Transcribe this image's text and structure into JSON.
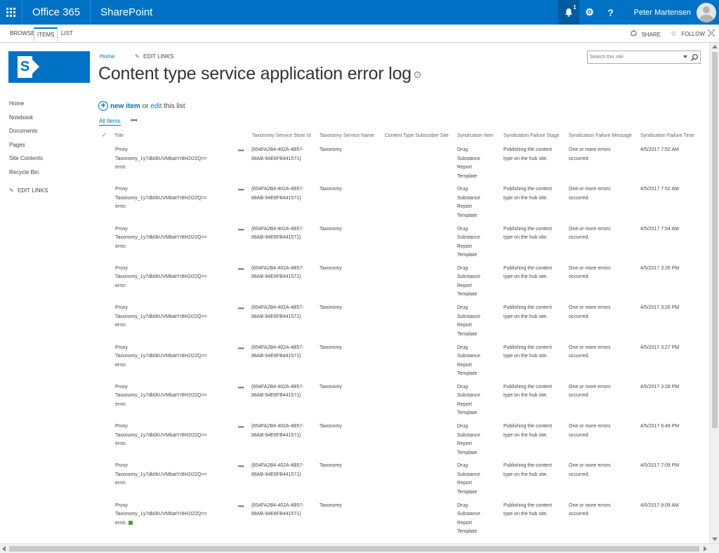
{
  "suite": {
    "brand": "Office 365",
    "app": "SharePoint",
    "notification_count": "1",
    "user_name": "Peter Martensen",
    "settings_glyph": "⚙",
    "help_glyph": "?",
    "bell_glyph": "🔔"
  },
  "ribbon": {
    "tabs": [
      "BROWSE",
      "ITEMS",
      "LIST"
    ],
    "selected_tab": "ITEMS",
    "share_label": "SHARE",
    "follow_label": "FOLLOW"
  },
  "logo": {
    "letter": "S"
  },
  "breadcrumb": {
    "home": "Home",
    "edit_links": "EDIT LINKS"
  },
  "page": {
    "title": "Content type service application error log"
  },
  "search": {
    "placeholder": "Search this site"
  },
  "leftnav": {
    "items": [
      "Home",
      "Notebook",
      "Documents",
      "Pages",
      "Site Contents",
      "Recycle Bin"
    ],
    "edit_links": "EDIT LINKS"
  },
  "commands": {
    "new_item": "new item",
    "or": " or ",
    "edit": "edit",
    "this_list": " this list",
    "view": "All Items",
    "more": "•••"
  },
  "list": {
    "columns": {
      "title": "Title",
      "store_id": "Taxonomy Service Store Id",
      "service_name": "Taxonomy Service Name",
      "subscriber_site": "Content Type Subscriber Site",
      "syndication_item": "Syndication Item",
      "failure_stage": "Syndication Failure Stage",
      "failure_message": "Syndication Failure Message",
      "failure_time": "Syndication Failure Time"
    },
    "rows": [
      {
        "title_line1": "Proxy",
        "title_line2": "Taxonomy_1y7db0kUVMbatYr8H2I22Q==",
        "title_line3": "error.",
        "store1": "{654FA2B4-402A-4B57-",
        "store2": "88AB-94E6FB441571}",
        "service": "Taxonomy",
        "item1": "Drug",
        "item2": "Substance",
        "item3": "Report",
        "item4": "Template",
        "stage1": "Publishing the content",
        "stage2": "type on the hub site.",
        "msg1": "One or more errors",
        "msg2": "occurred.",
        "time": "4/5/2017 7:52 AM"
      },
      {
        "title_line1": "Proxy",
        "title_line2": "Taxonomy_1y7db0kUVMbatYr8H2I22Q==",
        "title_line3": "error.",
        "store1": "{654FA2B4-402A-4B57-",
        "store2": "88AB-94E6FB441571}",
        "service": "Taxonomy",
        "item1": "Drug",
        "item2": "Substance",
        "item3": "Report",
        "item4": "Template",
        "stage1": "Publishing the content",
        "stage2": "type on the hub site.",
        "msg1": "One or more errors",
        "msg2": "occurred.",
        "time": "4/5/2017 7:52 AM"
      },
      {
        "title_line1": "Proxy",
        "title_line2": "Taxonomy_1y7db0kUVMbatYr8H2I22Q==",
        "title_line3": "error.",
        "store1": "{654FA2B4-402A-4B57-",
        "store2": "88AB-94E6FB441571}",
        "service": "Taxonomy",
        "item1": "Drug",
        "item2": "Substance",
        "item3": "Report",
        "item4": "Template",
        "stage1": "Publishing the content",
        "stage2": "type on the hub site.",
        "msg1": "One or more errors",
        "msg2": "occurred.",
        "time": "4/5/2017 7:54 AM"
      },
      {
        "title_line1": "Proxy",
        "title_line2": "Taxonomy_1y7db0kUVMbatYr8H2I22Q==",
        "title_line3": "error.",
        "store1": "{654FA2B4-402A-4B57-",
        "store2": "88AB-94E6FB441571}",
        "service": "Taxonomy",
        "item1": "Drug",
        "item2": "Substance",
        "item3": "Report",
        "item4": "Template",
        "stage1": "Publishing the content",
        "stage2": "type on the hub site.",
        "msg1": "One or more errors",
        "msg2": "occurred.",
        "time": "4/5/2017 3:26 PM"
      },
      {
        "title_line1": "Proxy",
        "title_line2": "Taxonomy_1y7db0kUVMbatYr8H2I22Q==",
        "title_line3": "error.",
        "store1": "{654FA2B4-402A-4B57-",
        "store2": "88AB-94E6FB441571}",
        "service": "Taxonomy",
        "item1": "Drug",
        "item2": "Substance",
        "item3": "Report",
        "item4": "Template",
        "stage1": "Publishing the content",
        "stage2": "type on the hub site.",
        "msg1": "One or more errors",
        "msg2": "occurred.",
        "time": "4/5/2017 3:26 PM"
      },
      {
        "title_line1": "Proxy",
        "title_line2": "Taxonomy_1y7db0kUVMbatYr8H2I22Q==",
        "title_line3": "error.",
        "store1": "{654FA2B4-402A-4B57-",
        "store2": "88AB-94E6FB441571}",
        "service": "Taxonomy",
        "item1": "Drug",
        "item2": "Substance",
        "item3": "Report",
        "item4": "Template",
        "stage1": "Publishing the content",
        "stage2": "type on the hub site.",
        "msg1": "One or more errors",
        "msg2": "occurred.",
        "time": "4/5/2017 3:27 PM"
      },
      {
        "title_line1": "Proxy",
        "title_line2": "Taxonomy_1y7db0kUVMbatYr8H2I22Q==",
        "title_line3": "error.",
        "store1": "{654FA2B4-402A-4B57-",
        "store2": "88AB-94E6FB441571}",
        "service": "Taxonomy",
        "item1": "Drug",
        "item2": "Substance",
        "item3": "Report",
        "item4": "Template",
        "stage1": "Publishing the content",
        "stage2": "type on the hub site.",
        "msg1": "One or more errors",
        "msg2": "occurred.",
        "time": "4/5/2017 3:28 PM"
      },
      {
        "title_line1": "Proxy",
        "title_line2": "Taxonomy_1y7db0kUVMbatYr8H2I22Q==",
        "title_line3": "error.",
        "store1": "{654FA2B4-402A-4B57-",
        "store2": "88AB-94E6FB441571}",
        "service": "Taxonomy",
        "item1": "Drug",
        "item2": "Substance",
        "item3": "Report",
        "item4": "Template",
        "stage1": "Publishing the content",
        "stage2": "type on the hub site.",
        "msg1": "One or more errors",
        "msg2": "occurred.",
        "time": "4/5/2017 6:48 PM"
      },
      {
        "title_line1": "Proxy",
        "title_line2": "Taxonomy_1y7db0kUVMbatYr8H2I22Q==",
        "title_line3": "error.",
        "store1": "{654FA2B4-402A-4B57-",
        "store2": "88AB-94E6FB441571}",
        "service": "Taxonomy",
        "item1": "Drug",
        "item2": "Substance",
        "item3": "Report",
        "item4": "Template",
        "stage1": "Publishing the content",
        "stage2": "type on the hub site.",
        "msg1": "One or more errors",
        "msg2": "occurred.",
        "time": "4/5/2017 7:09 PM"
      },
      {
        "title_line1": "Proxy",
        "title_line2": "Taxonomy_1y7db0kUVMbatYr8H2I22Q==",
        "title_line3": "error.",
        "store1": "{654FA2B4-402A-4B57-",
        "store2": "88AB-94E6FB441571}",
        "service": "Taxonomy",
        "item1": "Drug",
        "item2": "Substance",
        "item3": "Report",
        "item4": "Template",
        "stage1": "Publishing the content",
        "stage2": "type on the hub site.",
        "msg1": "One or more errors",
        "msg2": "occurred.",
        "time": "4/6/2017 9:09 AM",
        "is_new": true
      }
    ]
  }
}
